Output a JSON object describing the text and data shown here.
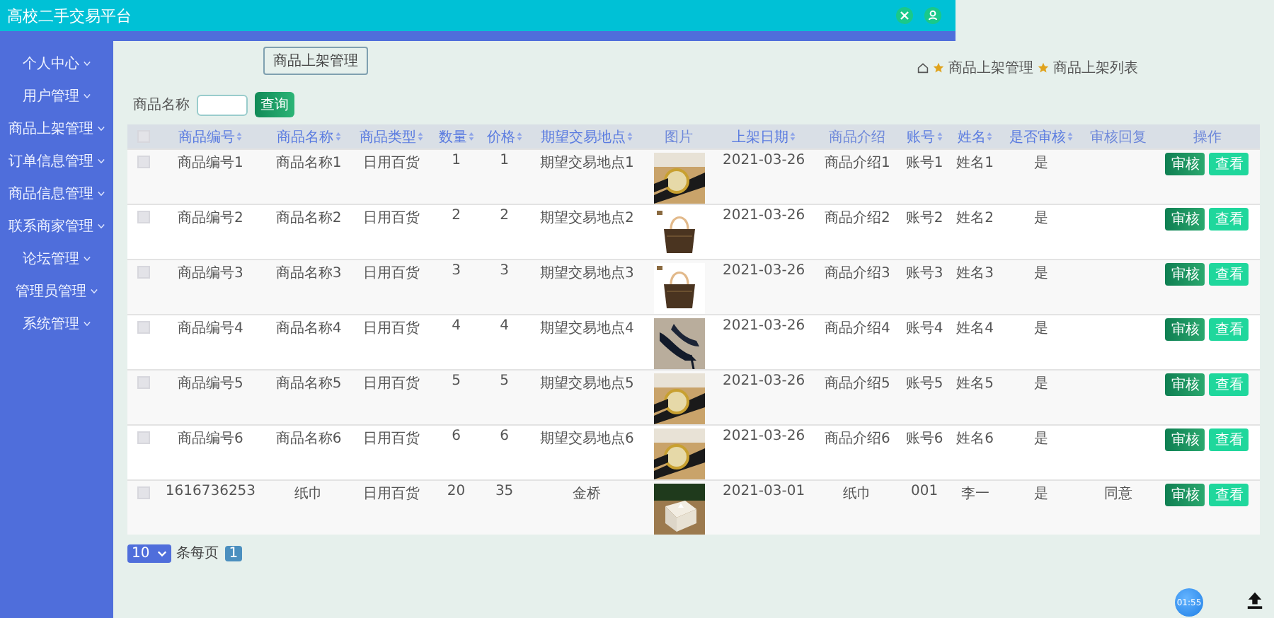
{
  "window": {
    "title": "高校二手交易平台"
  },
  "sidebar": {
    "items": [
      {
        "label": "个人中心"
      },
      {
        "label": "用户管理"
      },
      {
        "label": "商品上架管理"
      },
      {
        "label": "订单信息管理"
      },
      {
        "label": "商品信息管理"
      },
      {
        "label": "联系商家管理"
      },
      {
        "label": "论坛管理"
      },
      {
        "label": "管理员管理"
      },
      {
        "label": "系统管理"
      }
    ]
  },
  "page_button": "商品上架管理",
  "breadcrumb": [
    "商品上架管理",
    "商品上架列表"
  ],
  "search": {
    "label": "商品名称",
    "button": "查询"
  },
  "table": {
    "select_all": {
      "checked": false
    },
    "columns": [
      {
        "label": "商品编号",
        "sortable": true
      },
      {
        "label": "商品名称",
        "sortable": true
      },
      {
        "label": "商品类型",
        "sortable": true
      },
      {
        "label": "数量",
        "sortable": true
      },
      {
        "label": "价格",
        "sortable": true
      },
      {
        "label": "期望交易地点",
        "sortable": true
      },
      {
        "label": "图片",
        "sortable": false,
        "kind": "picture"
      },
      {
        "label": "上架日期",
        "sortable": true
      },
      {
        "label": "商品介绍",
        "sortable": false
      },
      {
        "label": "账号",
        "sortable": true
      },
      {
        "label": "姓名",
        "sortable": true
      },
      {
        "label": "是否审核",
        "sortable": true
      },
      {
        "label": "审核回复",
        "sortable": false
      },
      {
        "label": "操作",
        "sortable": false,
        "kind": "actions"
      }
    ],
    "rows": [
      {
        "checked": false,
        "cells": [
          "商品编号1",
          "商品名称1",
          "日用百货",
          "1",
          "1",
          "期望交易地点1",
          {
            "kind": "picture"
          },
          "2021-03-26",
          "商品介绍1",
          "账号1",
          "姓名1",
          "是",
          ""
        ],
        "actions": [
          "审核",
          "查看"
        ]
      },
      {
        "checked": false,
        "cells": [
          "商品编号2",
          "商品名称2",
          "日用百货",
          "2",
          "2",
          "期望交易地点2",
          {
            "kind": "picture"
          },
          "2021-03-26",
          "商品介绍2",
          "账号2",
          "姓名2",
          "是",
          ""
        ],
        "actions": [
          "审核",
          "查看"
        ]
      },
      {
        "checked": false,
        "cells": [
          "商品编号3",
          "商品名称3",
          "日用百货",
          "3",
          "3",
          "期望交易地点3",
          {
            "kind": "picture"
          },
          "2021-03-26",
          "商品介绍3",
          "账号3",
          "姓名3",
          "是",
          ""
        ],
        "actions": [
          "审核",
          "查看"
        ]
      },
      {
        "checked": false,
        "cells": [
          "商品编号4",
          "商品名称4",
          "日用百货",
          "4",
          "4",
          "期望交易地点4",
          {
            "kind": "picture"
          },
          "2021-03-26",
          "商品介绍4",
          "账号4",
          "姓名4",
          "是",
          ""
        ],
        "actions": [
          "审核",
          "查看"
        ]
      },
      {
        "checked": false,
        "cells": [
          "商品编号5",
          "商品名称5",
          "日用百货",
          "5",
          "5",
          "期望交易地点5",
          {
            "kind": "picture"
          },
          "2021-03-26",
          "商品介绍5",
          "账号5",
          "姓名5",
          "是",
          ""
        ],
        "actions": [
          "审核",
          "查看"
        ]
      },
      {
        "checked": false,
        "cells": [
          "商品编号6",
          "商品名称6",
          "日用百货",
          "6",
          "6",
          "期望交易地点6",
          {
            "kind": "picture"
          },
          "2021-03-26",
          "商品介绍6",
          "账号6",
          "姓名6",
          "是",
          ""
        ],
        "actions": [
          "审核",
          "查看"
        ]
      },
      {
        "checked": false,
        "cells": [
          "1616736253",
          "纸巾",
          "日用百货",
          "20",
          "35",
          "金桥",
          {
            "kind": "picture"
          },
          "2021-03-01",
          "纸巾",
          "001",
          "李一",
          "是",
          "同意"
        ],
        "actions": [
          "审核",
          "查看"
        ]
      }
    ]
  },
  "pagination": {
    "page_size": "10",
    "label": "条每页",
    "page": "1"
  },
  "timer": "01:55"
}
